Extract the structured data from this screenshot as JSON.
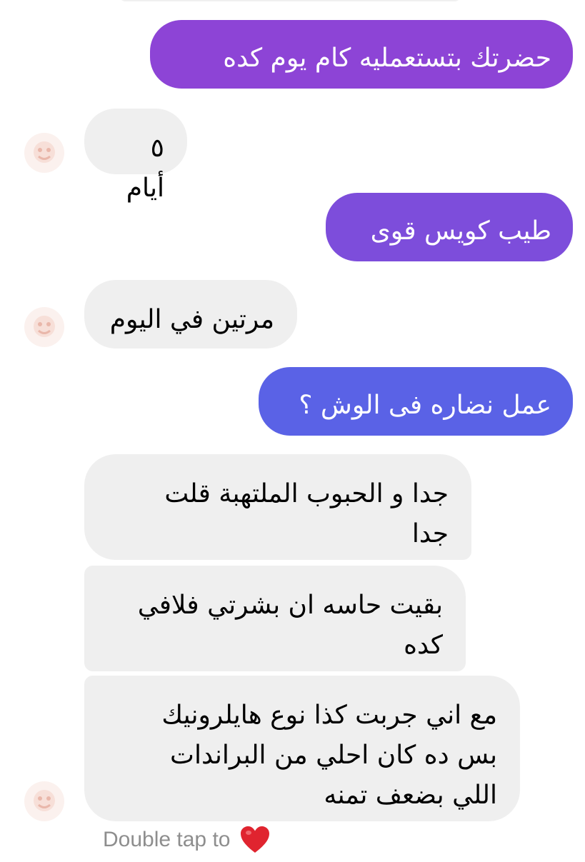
{
  "colors": {
    "sent_bubble_1": "#8d44d6",
    "sent_bubble_2": "#7d4ddb",
    "sent_bubble_3": "#5a62e6",
    "received_bubble": "#efefef",
    "received_text": "#000000",
    "sent_text": "#ffffff",
    "hint_text": "#8e8e8e",
    "heart": "#e0242f"
  },
  "messages": [
    {
      "from": "me",
      "text": "حضرتك بتستعمليه كام يوم كده"
    },
    {
      "from": "them",
      "text": "٥ أيام"
    },
    {
      "from": "me",
      "text": "طيب كويس قوى"
    },
    {
      "from": "them",
      "text": "مرتين في اليوم"
    },
    {
      "from": "me",
      "text": "عمل نضاره فى الوش ؟"
    },
    {
      "from": "them",
      "text": "جدا و الحبوب الملتهبة قلت\nجدا"
    },
    {
      "from": "them",
      "text": "بقيت حاسه ان بشرتي فلافي\nكده"
    },
    {
      "from": "them",
      "text": "مع اني جربت كذا نوع هايلرونيك\nبس ده كان احلي من البراندات\nاللي بضعف تمنه"
    }
  ],
  "footer": {
    "hint": "Double tap to",
    "icon": "red-heart-icon"
  },
  "avatar": {
    "icon": "profile-avatar-icon"
  }
}
